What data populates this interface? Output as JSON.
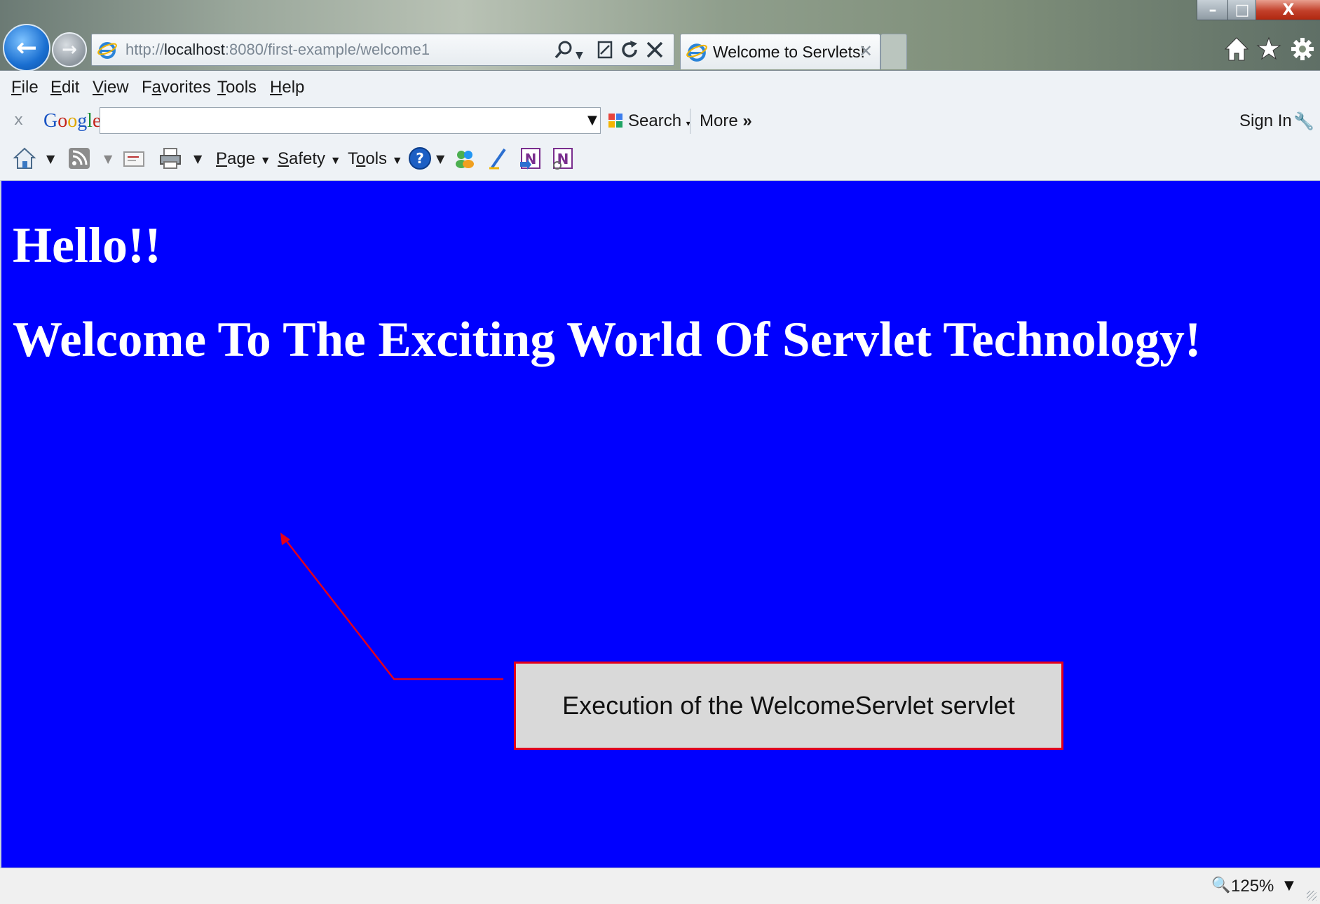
{
  "browser": {
    "address_prefix": "http://",
    "address_host": "localhost",
    "address_rest": ":8080/first-example/welcome1",
    "tab_title": "Welcome to Servlets!",
    "back_glyph": "←",
    "forward_glyph": "→",
    "window_buttons": {
      "minimize": "–",
      "maximize": "□",
      "close": "X"
    }
  },
  "menu": {
    "items": [
      {
        "pre": "",
        "key": "F",
        "post": "ile"
      },
      {
        "pre": "",
        "key": "E",
        "post": "dit"
      },
      {
        "pre": "",
        "key": "V",
        "post": "iew"
      },
      {
        "pre": "F",
        "key": "a",
        "post": "vorites"
      },
      {
        "pre": "",
        "key": "T",
        "post": "ools"
      },
      {
        "pre": "",
        "key": "H",
        "post": "elp"
      }
    ]
  },
  "google_toolbar": {
    "close": "x",
    "logo_letters": [
      "G",
      "o",
      "o",
      "g",
      "l",
      "e"
    ],
    "logo_colors": [
      "#1a55c4",
      "#c4241a",
      "#e0a800",
      "#1a55c4",
      "#1a8d34",
      "#c4241a"
    ],
    "search_value": "",
    "search_label": "Search",
    "more_label": "More",
    "more_glyph": "»",
    "sign_in_label": "Sign In"
  },
  "command_bar": {
    "page_key": "P",
    "page_rest": "age",
    "safety_key": "S",
    "safety_rest": "afety",
    "tools_pre": "T",
    "tools_key": "o",
    "tools_rest": "ols"
  },
  "content": {
    "background": "#0000ff",
    "hello": "Hello!!",
    "welcome": "Welcome To The Exciting World Of Servlet Technology!",
    "callout_text": "Execution of the WelcomeServlet servlet",
    "callout_border": "#e3001b"
  },
  "status": {
    "zoom": "125%"
  },
  "icons": {
    "back": "back-arrow-icon",
    "forward": "forward-arrow-icon",
    "address": "internet-explorer-icon",
    "search": "search-icon",
    "refresh": "refresh-icon",
    "stop": "stop-icon",
    "home": "home-icon",
    "favorites": "star-icon",
    "settings": "gear-icon",
    "rss": "rss-icon",
    "mail": "mail-icon",
    "print": "print-icon",
    "help": "help-icon",
    "onenote": "onenote-icon",
    "zoom": "zoom-icon"
  }
}
